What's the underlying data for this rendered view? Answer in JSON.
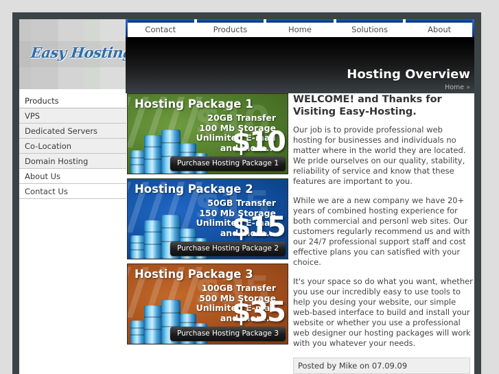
{
  "site": {
    "logo_text": "Easy Hosting"
  },
  "nav": {
    "items": [
      {
        "label": "Contact"
      },
      {
        "label": "Products"
      },
      {
        "label": "Home"
      },
      {
        "label": "Solutions"
      },
      {
        "label": "About"
      }
    ]
  },
  "banner": {
    "title": "Hosting Overview",
    "breadcrumb": "Home",
    "breadcrumb_chevron": "»"
  },
  "sidebar": {
    "items": [
      {
        "label": "Products"
      },
      {
        "label": "VPS"
      },
      {
        "label": "Dedicated Servers"
      },
      {
        "label": "Co-Location"
      },
      {
        "label": "Domain Hosting"
      },
      {
        "label": "About Us"
      },
      {
        "label": "Contact Us"
      }
    ]
  },
  "packages": [
    {
      "title": "Hosting Package 1",
      "transfer": "20GB Transfer",
      "storage": "100 Mb Storage",
      "email": "Unlimited E-mail",
      "more": "and more...",
      "price": "$10",
      "ghost_price": "$10",
      "button": "Purchase Hosting Package 1",
      "color": "#4f7a2a"
    },
    {
      "title": "Hosting Package 2",
      "transfer": "50GB Transfer",
      "storage": "150 Mb Storage",
      "email": "Unlimited E-mail",
      "more": "and more...",
      "price": "$15",
      "ghost_price": "$15",
      "button": "Purchase Hosting Package 2",
      "color": "#114f9e"
    },
    {
      "title": "Hosting Package 3",
      "transfer": "100GB Transfer",
      "storage": "500 Mb Storage",
      "email": "Unlimited E-mail",
      "more": "and more...",
      "price": "$35",
      "ghost_price": "$35",
      "button": "Purchase Hosting Package 3",
      "color": "#a4501d"
    }
  ],
  "article": {
    "heading": "WELCOME! and Thanks for Visiting Easy-Hosting.",
    "paragraph1": "Our job is to provide professional web hosting for businesses and individuals no matter where in the world they are located. We pride ourselves on our quality, stability, reliability of service and know that these features are important to you.",
    "paragraph2": "While we are a new company we have 20+ years of combined hosting experience for both commercial and personl web sites. Our customers regularly recommend us and with our 24/7 professional support staff and cost effective plans you can satisfied with your choice.",
    "paragraph3": "It's your space so do what you want, whether you use our incredibly easy to use tools to help you desing your website, our simple web-based interface to build and install your website or whether you use a professional web designer our hosting packages will work with you whatever your needs.",
    "posted": "Posted by Mike on 07.09.09"
  }
}
